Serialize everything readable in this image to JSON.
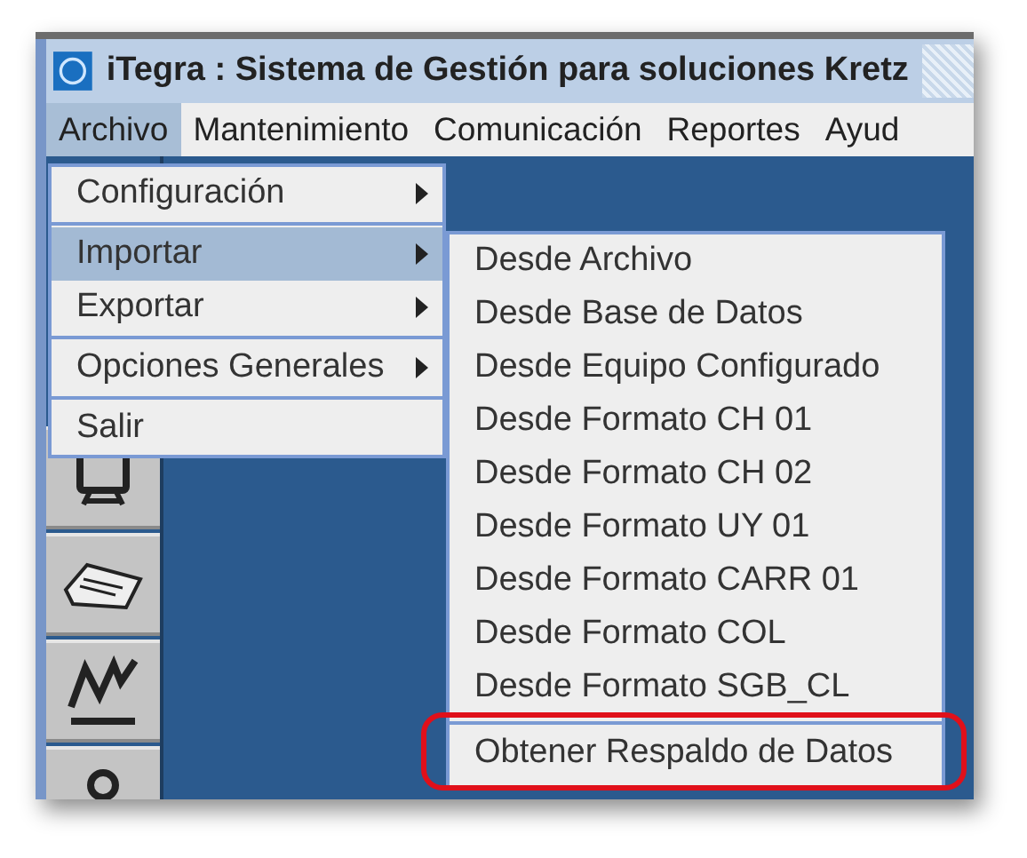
{
  "window": {
    "title": "iTegra : Sistema de Gestión para soluciones Kretz"
  },
  "menubar": [
    {
      "label": "Archivo",
      "selected": true
    },
    {
      "label": "Mantenimiento",
      "selected": false
    },
    {
      "label": "Comunicación",
      "selected": false
    },
    {
      "label": "Reportes",
      "selected": false
    },
    {
      "label": "Ayud",
      "selected": false
    }
  ],
  "archivo_menu": [
    {
      "kind": "item",
      "label": "Configuración",
      "submenu": true,
      "selected": false
    },
    {
      "kind": "separator"
    },
    {
      "kind": "item",
      "label": "Importar",
      "submenu": true,
      "selected": true
    },
    {
      "kind": "item",
      "label": "Exportar",
      "submenu": true,
      "selected": false
    },
    {
      "kind": "separator"
    },
    {
      "kind": "item",
      "label": "Opciones Generales",
      "submenu": true,
      "selected": false
    },
    {
      "kind": "separator"
    },
    {
      "kind": "item",
      "label": "Salir",
      "submenu": false,
      "selected": false
    }
  ],
  "importar_menu": [
    {
      "kind": "item",
      "label": "Desde Archivo",
      "highlighted": false
    },
    {
      "kind": "item",
      "label": "Desde Base de Datos",
      "highlighted": false
    },
    {
      "kind": "item",
      "label": "Desde Equipo Configurado",
      "highlighted": false
    },
    {
      "kind": "item",
      "label": "Desde Formato CH 01",
      "highlighted": false
    },
    {
      "kind": "item",
      "label": "Desde Formato CH 02",
      "highlighted": false
    },
    {
      "kind": "item",
      "label": "Desde Formato UY 01",
      "highlighted": false
    },
    {
      "kind": "item",
      "label": "Desde Formato CARR 01",
      "highlighted": false
    },
    {
      "kind": "item",
      "label": "Desde Formato COL",
      "highlighted": false
    },
    {
      "kind": "item",
      "label": "Desde Formato SGB_CL",
      "highlighted": false
    },
    {
      "kind": "separator"
    },
    {
      "kind": "item",
      "label": "Obtener Respaldo de Datos",
      "highlighted": true
    }
  ]
}
